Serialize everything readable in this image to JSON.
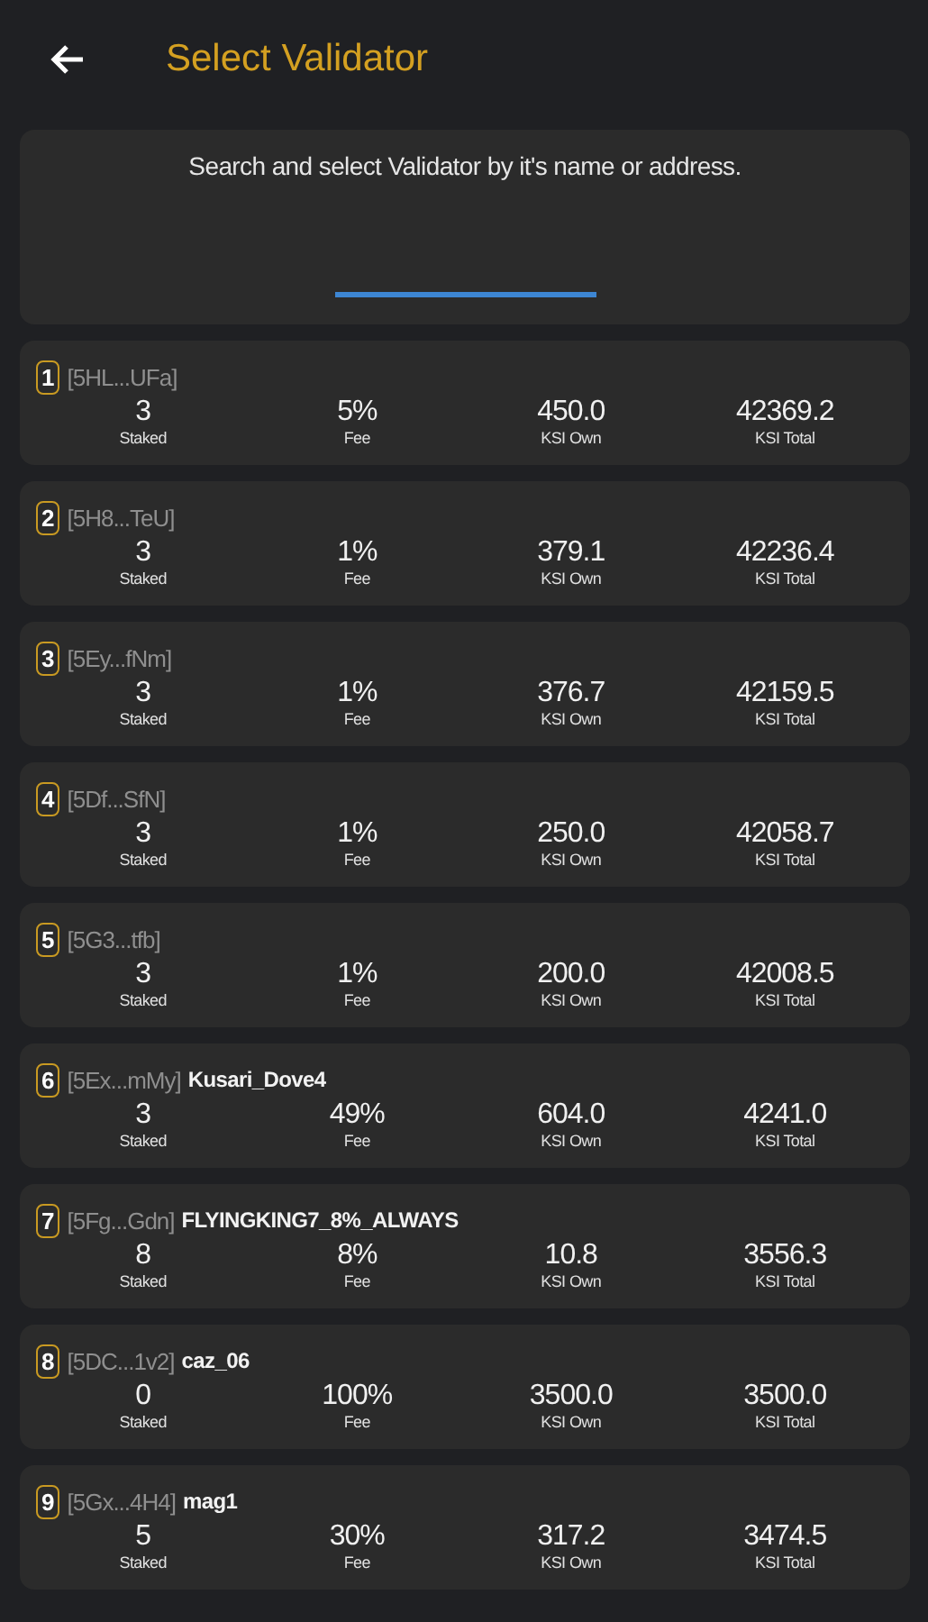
{
  "header": {
    "title": "Select Validator"
  },
  "search": {
    "hint": "Search and select Validator by it's name or address."
  },
  "validators": [
    {
      "rank": "1",
      "address": "[5HL...UFa]",
      "stats": [
        {
          "value": "3",
          "label": "Staked"
        },
        {
          "value": "5%",
          "label": "Fee"
        },
        {
          "value": "450.0",
          "label": "KSI Own"
        },
        {
          "value": "42369.2",
          "label": "KSI Total"
        }
      ]
    },
    {
      "rank": "2",
      "address": "[5H8...TeU]",
      "stats": [
        {
          "value": "3",
          "label": "Staked"
        },
        {
          "value": "1%",
          "label": "Fee"
        },
        {
          "value": "379.1",
          "label": "KSI Own"
        },
        {
          "value": "42236.4",
          "label": "KSI Total"
        }
      ]
    },
    {
      "rank": "3",
      "address": "[5Ey...fNm]",
      "stats": [
        {
          "value": "3",
          "label": "Staked"
        },
        {
          "value": "1%",
          "label": "Fee"
        },
        {
          "value": "376.7",
          "label": "KSI Own"
        },
        {
          "value": "42159.5",
          "label": "KSI Total"
        }
      ]
    },
    {
      "rank": "4",
      "address": "[5Df...SfN]",
      "stats": [
        {
          "value": "3",
          "label": "Staked"
        },
        {
          "value": "1%",
          "label": "Fee"
        },
        {
          "value": "250.0",
          "label": "KSI Own"
        },
        {
          "value": "42058.7",
          "label": "KSI Total"
        }
      ]
    },
    {
      "rank": "5",
      "address": "[5G3...tfb]",
      "stats": [
        {
          "value": "3",
          "label": "Staked"
        },
        {
          "value": "1%",
          "label": "Fee"
        },
        {
          "value": "200.0",
          "label": "KSI Own"
        },
        {
          "value": "42008.5",
          "label": "KSI Total"
        }
      ]
    },
    {
      "rank": "6",
      "address": "[5Ex...mMy]",
      "name": "Kusari_Dove4",
      "stats": [
        {
          "value": "3",
          "label": "Staked"
        },
        {
          "value": "49%",
          "label": "Fee"
        },
        {
          "value": "604.0",
          "label": "KSI Own"
        },
        {
          "value": "4241.0",
          "label": "KSI Total"
        }
      ]
    },
    {
      "rank": "7",
      "address": "[5Fg...Gdn]",
      "name": "FLYINGKING7_8%_ALWAYS",
      "stats": [
        {
          "value": "8",
          "label": "Staked"
        },
        {
          "value": "8%",
          "label": "Fee"
        },
        {
          "value": "10.8",
          "label": "KSI Own"
        },
        {
          "value": "3556.3",
          "label": "KSI Total"
        }
      ]
    },
    {
      "rank": "8",
      "address": "[5DC...1v2]",
      "name": "caz_06",
      "stats": [
        {
          "value": "0",
          "label": "Staked"
        },
        {
          "value": "100%",
          "label": "Fee"
        },
        {
          "value": "3500.0",
          "label": "KSI Own"
        },
        {
          "value": "3500.0",
          "label": "KSI Total"
        }
      ]
    },
    {
      "rank": "9",
      "address": "[5Gx...4H4]",
      "name": "mag1",
      "stats": [
        {
          "value": "5",
          "label": "Staked"
        },
        {
          "value": "30%",
          "label": "Fee"
        },
        {
          "value": "317.2",
          "label": "KSI Own"
        },
        {
          "value": "3474.5",
          "label": "KSI Total"
        }
      ]
    }
  ]
}
